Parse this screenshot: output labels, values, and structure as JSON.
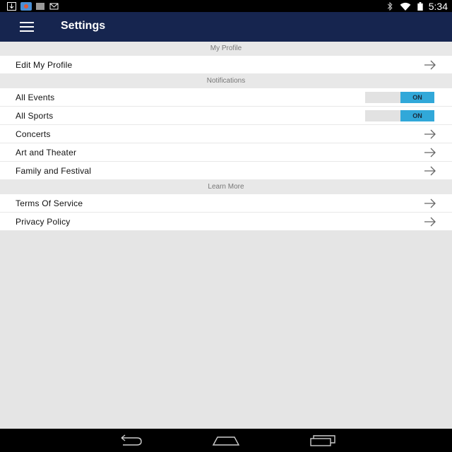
{
  "status_bar": {
    "time": "5:34",
    "icons_left": [
      "download-icon",
      "app-notification-icon",
      "barcode-icon",
      "gmail-icon"
    ],
    "icons_right": [
      "bluetooth-icon",
      "wifi-icon",
      "battery-icon"
    ]
  },
  "app_bar": {
    "title": "Settings",
    "menu_icon": "hamburger-menu-icon",
    "color": "#16254f"
  },
  "sections": [
    {
      "header": "My Profile",
      "rows": [
        {
          "label": "Edit My Profile",
          "control": "arrow"
        }
      ]
    },
    {
      "header": "Notifications",
      "rows": [
        {
          "label": "All Events",
          "control": "toggle",
          "toggle_text": "ON"
        },
        {
          "label": "All Sports",
          "control": "toggle",
          "toggle_text": "ON"
        },
        {
          "label": "Concerts",
          "control": "arrow"
        },
        {
          "label": "Art and Theater",
          "control": "arrow"
        },
        {
          "label": "Family and Festival",
          "control": "arrow"
        }
      ]
    },
    {
      "header": "Learn More",
      "rows": [
        {
          "label": "Terms Of Service",
          "control": "arrow"
        },
        {
          "label": "Privacy Policy",
          "control": "arrow"
        }
      ]
    }
  ],
  "colors": {
    "toggle_on": "#31a8d9",
    "background": "#e5e5e5"
  },
  "nav_bar": {
    "buttons": [
      "back-icon",
      "home-icon",
      "recent-apps-icon"
    ]
  }
}
